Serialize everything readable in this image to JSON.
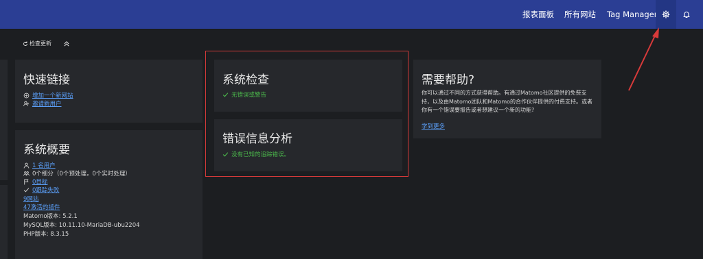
{
  "topbar": {
    "nav": [
      "报表面板",
      "所有网站",
      "Tag Manager"
    ],
    "settings_icon": "gear-icon",
    "notification_icon": "bell-icon",
    "bg_color": "#2b3e94"
  },
  "toolbar": {
    "refresh_label": "检查更新",
    "refresh_icon": "refresh-icon",
    "collapse_icon": "double-chevron-up-icon"
  },
  "quick_links": {
    "title": "快速链接",
    "items": [
      {
        "label": "增加一个新网站",
        "icon": "add-site-icon"
      },
      {
        "label": "邀请新用户",
        "icon": "add-user-icon"
      }
    ]
  },
  "system_overview": {
    "title": "系统概要",
    "rows": [
      {
        "icon": "user-icon",
        "text": "1 名用户",
        "link": true
      },
      {
        "icon": "segment-icon",
        "text": "0个细分（0个预处理，0个实时处理）",
        "link": false
      },
      {
        "icon": "flag-icon",
        "text": "0目标",
        "link": true
      },
      {
        "icon": "check-icon",
        "text": "0跟踪失败",
        "link": true
      },
      {
        "icon": "",
        "text": "9网站",
        "link": true
      },
      {
        "icon": "",
        "text": "47激活的插件",
        "link": true
      },
      {
        "icon": "",
        "text": "Matomo版本: 5.2.1",
        "link": false
      },
      {
        "icon": "",
        "text": "MySQL版本: 10.11.10-MariaDB-ubu2204",
        "link": false
      },
      {
        "icon": "",
        "text": "PHP版本: 8.3.15",
        "link": false
      }
    ]
  },
  "system_check": {
    "title": "系统检查",
    "status": "无错误或警告"
  },
  "error_analysis": {
    "title": "错误信息分析",
    "status": "没有已知的追踪错误。"
  },
  "help": {
    "title": "需要帮助?",
    "body": "你可以通过不同的方式获得帮助。有通过Matomo社区提供的免费支持，以及由Matomo团队和Matomo的合作伙伴提供的付费支持。或者你有一个错误要报告或者想建议一个新的功能?",
    "link": "学到更多"
  },
  "colors": {
    "link": "#5a9df5",
    "success": "#4bb84b",
    "annotation": "#d73a3a"
  }
}
